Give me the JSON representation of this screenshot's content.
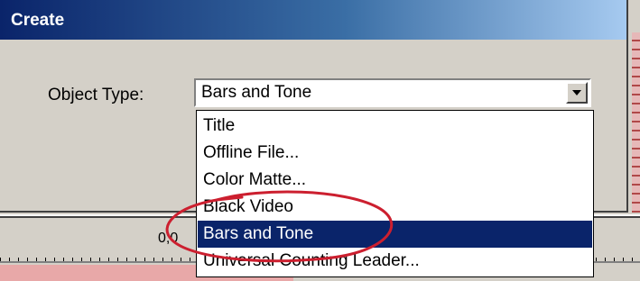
{
  "dialog": {
    "title": "Create",
    "object_type_label": "Object Type:",
    "object_type_value": "Bars and Tone"
  },
  "dropdown": {
    "items": [
      {
        "label": "Title"
      },
      {
        "label": "Offline File..."
      },
      {
        "label": "Color Matte..."
      },
      {
        "label": "Black Video"
      },
      {
        "label": "Bars and Tone",
        "selected": true
      },
      {
        "label": "Universal Counting Leader..."
      }
    ]
  },
  "background": {
    "timecode_partial": "0;0"
  },
  "icons": {
    "combo_arrow": "chevron-down-icon"
  },
  "colors": {
    "titlebar_start": "#0a246a",
    "titlebar_end": "#a6caf0",
    "selection": "#0a246a",
    "annotation": "#cc1f2f",
    "window_face": "#d4d0c8"
  }
}
